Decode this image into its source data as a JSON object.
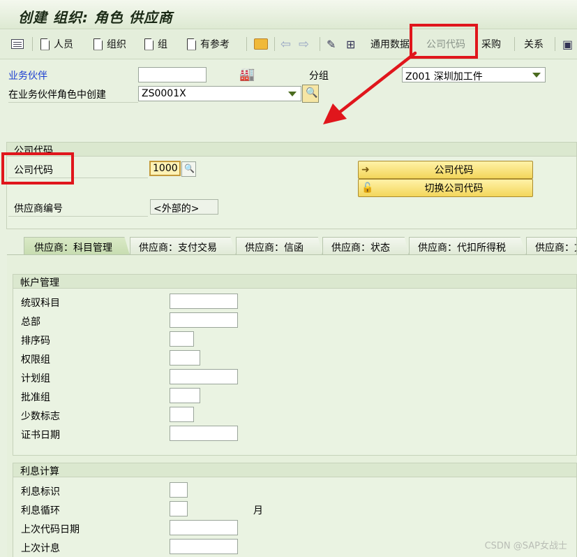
{
  "window": {
    "title": "创建 组织: 角色 供应商"
  },
  "toolbar": {
    "person": "人员",
    "org": "组织",
    "group": "组",
    "reference": "有参考",
    "general_data": "通用数据",
    "company_code": "公司代码",
    "purchasing": "采购",
    "relationships": "关系"
  },
  "header": {
    "bp_label": "业务伙伴",
    "bp_value": "",
    "grouping_label": "分组",
    "grouping_value": "Z001 深圳加工件",
    "create_in_role_label": "在业务伙伴角色中创建",
    "create_in_role_value": "ZS0001X"
  },
  "company_section": {
    "title": "公司代码",
    "company_code_label": "公司代码",
    "company_code_value": "1000",
    "vendor_no_label": "供应商编号",
    "vendor_no_value": "<外部的>",
    "btn_company_code": "公司代码",
    "btn_switch_company_code": "切换公司代码"
  },
  "tabs": [
    {
      "label": "供应商：科目管理"
    },
    {
      "label": "供应商：支付交易"
    },
    {
      "label": "供应商：信函"
    },
    {
      "label": "供应商：状态"
    },
    {
      "label": "供应商：代扣所得税"
    },
    {
      "label": "供应商：文"
    }
  ],
  "account_mgmt": {
    "title": "帐户管理",
    "fields": [
      {
        "label": "统驭科目"
      },
      {
        "label": "总部"
      },
      {
        "label": "排序码"
      },
      {
        "label": "权限组"
      },
      {
        "label": "计划组"
      },
      {
        "label": "批准组"
      },
      {
        "label": "少数标志"
      },
      {
        "label": "证书日期"
      }
    ]
  },
  "interest": {
    "title": "利息计算",
    "fields": [
      {
        "label": "利息标识"
      },
      {
        "label": "利息循环"
      },
      {
        "label": "上次代码日期"
      },
      {
        "label": "上次计息"
      }
    ],
    "month_label": "月"
  },
  "watermark": "CSDN @SAP女战士",
  "colors": {
    "annotation": "#e0161c",
    "accent": "#f3d65b"
  }
}
